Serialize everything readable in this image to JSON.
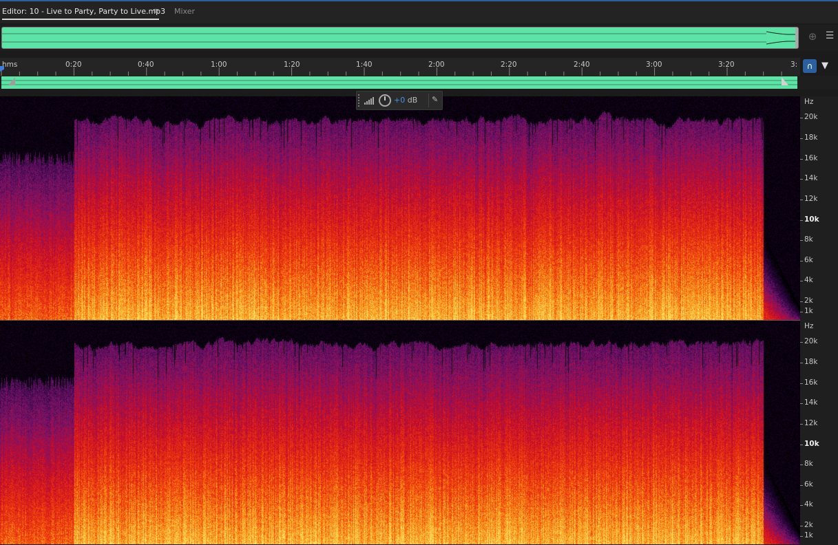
{
  "window": {
    "editor_tab_label": "Editor: 10 - Live to Party, Party to Live.mp3",
    "tab_menu_glyph": "≡",
    "mixer_tab_label": "Mixer"
  },
  "ruler": {
    "unit_label": "hms",
    "ticks": [
      "0:20",
      "0:40",
      "1:00",
      "1:20",
      "1:40",
      "2:00",
      "2:20",
      "2:40",
      "3:00",
      "3:20",
      "3:"
    ]
  },
  "hud": {
    "volume_value": "+0",
    "volume_unit": "dB"
  },
  "frequency_scale": {
    "unit": "Hz",
    "labels": [
      "20k",
      "18k",
      "16k",
      "14k",
      "12k",
      "10k",
      "8k",
      "6k",
      "4k",
      "2k",
      "1k"
    ]
  },
  "icons": {
    "zoom": "zoom-to-selection-icon",
    "list": "list-panel-icon",
    "snap": "snap-magnet-icon",
    "marker": "marker-pin-icon",
    "pin": "pin-icon",
    "knob": "volume-knob-icon",
    "meter": "level-meter-icon"
  },
  "colors": {
    "waveform": "#5de3a6",
    "accent": "#3d7fdd",
    "volume_text": "#4a8fe7"
  }
}
